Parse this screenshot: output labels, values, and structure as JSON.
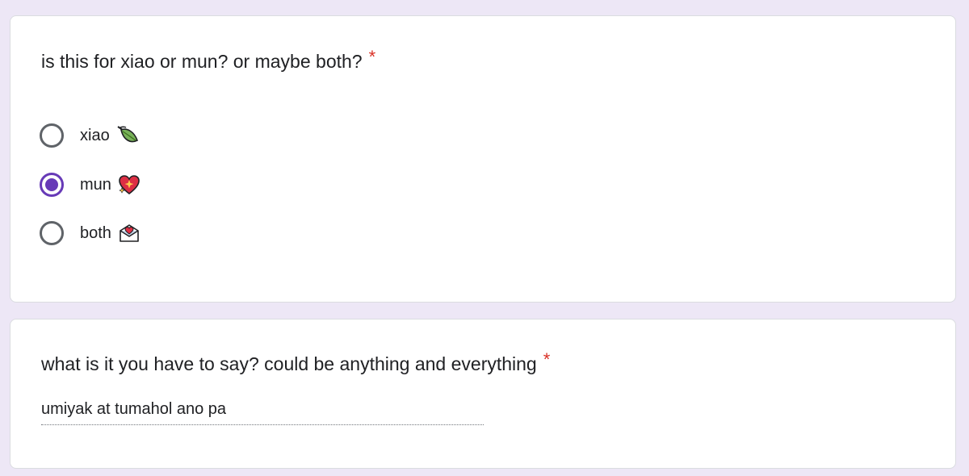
{
  "questions": [
    {
      "title": "is this for xiao or mun? or maybe both?",
      "required_mark": "*",
      "options": [
        {
          "label": "xiao",
          "icon": "leaf-icon",
          "selected": false
        },
        {
          "label": "mun",
          "icon": "sparkling-heart-icon",
          "selected": true
        },
        {
          "label": "both",
          "icon": "envelope-heart-icon",
          "selected": false
        }
      ]
    },
    {
      "title": "what is it you have to say? could be anything and everything",
      "required_mark": "*",
      "answer": "umiyak at tumahol ano pa"
    }
  ],
  "colors": {
    "background": "#ede7f6",
    "accent": "#673ab7",
    "required": "#d93025",
    "radio_unselected": "#5f6368"
  }
}
